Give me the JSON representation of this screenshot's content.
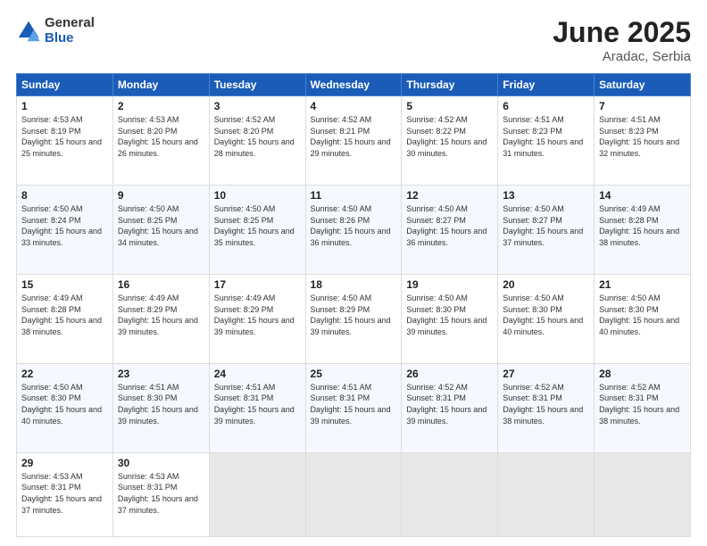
{
  "logo": {
    "general": "General",
    "blue": "Blue"
  },
  "title": {
    "month_year": "June 2025",
    "location": "Aradac, Serbia"
  },
  "headers": [
    "Sunday",
    "Monday",
    "Tuesday",
    "Wednesday",
    "Thursday",
    "Friday",
    "Saturday"
  ],
  "weeks": [
    [
      {
        "day": "1",
        "sunrise": "4:53 AM",
        "sunset": "8:19 PM",
        "daylight": "15 hours and 25 minutes."
      },
      {
        "day": "2",
        "sunrise": "4:53 AM",
        "sunset": "8:20 PM",
        "daylight": "15 hours and 26 minutes."
      },
      {
        "day": "3",
        "sunrise": "4:52 AM",
        "sunset": "8:20 PM",
        "daylight": "15 hours and 28 minutes."
      },
      {
        "day": "4",
        "sunrise": "4:52 AM",
        "sunset": "8:21 PM",
        "daylight": "15 hours and 29 minutes."
      },
      {
        "day": "5",
        "sunrise": "4:52 AM",
        "sunset": "8:22 PM",
        "daylight": "15 hours and 30 minutes."
      },
      {
        "day": "6",
        "sunrise": "4:51 AM",
        "sunset": "8:23 PM",
        "daylight": "15 hours and 31 minutes."
      },
      {
        "day": "7",
        "sunrise": "4:51 AM",
        "sunset": "8:23 PM",
        "daylight": "15 hours and 32 minutes."
      }
    ],
    [
      {
        "day": "8",
        "sunrise": "4:50 AM",
        "sunset": "8:24 PM",
        "daylight": "15 hours and 33 minutes."
      },
      {
        "day": "9",
        "sunrise": "4:50 AM",
        "sunset": "8:25 PM",
        "daylight": "15 hours and 34 minutes."
      },
      {
        "day": "10",
        "sunrise": "4:50 AM",
        "sunset": "8:25 PM",
        "daylight": "15 hours and 35 minutes."
      },
      {
        "day": "11",
        "sunrise": "4:50 AM",
        "sunset": "8:26 PM",
        "daylight": "15 hours and 36 minutes."
      },
      {
        "day": "12",
        "sunrise": "4:50 AM",
        "sunset": "8:27 PM",
        "daylight": "15 hours and 36 minutes."
      },
      {
        "day": "13",
        "sunrise": "4:50 AM",
        "sunset": "8:27 PM",
        "daylight": "15 hours and 37 minutes."
      },
      {
        "day": "14",
        "sunrise": "4:49 AM",
        "sunset": "8:28 PM",
        "daylight": "15 hours and 38 minutes."
      }
    ],
    [
      {
        "day": "15",
        "sunrise": "4:49 AM",
        "sunset": "8:28 PM",
        "daylight": "15 hours and 38 minutes."
      },
      {
        "day": "16",
        "sunrise": "4:49 AM",
        "sunset": "8:29 PM",
        "daylight": "15 hours and 39 minutes."
      },
      {
        "day": "17",
        "sunrise": "4:49 AM",
        "sunset": "8:29 PM",
        "daylight": "15 hours and 39 minutes."
      },
      {
        "day": "18",
        "sunrise": "4:50 AM",
        "sunset": "8:29 PM",
        "daylight": "15 hours and 39 minutes."
      },
      {
        "day": "19",
        "sunrise": "4:50 AM",
        "sunset": "8:30 PM",
        "daylight": "15 hours and 39 minutes."
      },
      {
        "day": "20",
        "sunrise": "4:50 AM",
        "sunset": "8:30 PM",
        "daylight": "15 hours and 40 minutes."
      },
      {
        "day": "21",
        "sunrise": "4:50 AM",
        "sunset": "8:30 PM",
        "daylight": "15 hours and 40 minutes."
      }
    ],
    [
      {
        "day": "22",
        "sunrise": "4:50 AM",
        "sunset": "8:30 PM",
        "daylight": "15 hours and 40 minutes."
      },
      {
        "day": "23",
        "sunrise": "4:51 AM",
        "sunset": "8:30 PM",
        "daylight": "15 hours and 39 minutes."
      },
      {
        "day": "24",
        "sunrise": "4:51 AM",
        "sunset": "8:31 PM",
        "daylight": "15 hours and 39 minutes."
      },
      {
        "day": "25",
        "sunrise": "4:51 AM",
        "sunset": "8:31 PM",
        "daylight": "15 hours and 39 minutes."
      },
      {
        "day": "26",
        "sunrise": "4:52 AM",
        "sunset": "8:31 PM",
        "daylight": "15 hours and 39 minutes."
      },
      {
        "day": "27",
        "sunrise": "4:52 AM",
        "sunset": "8:31 PM",
        "daylight": "15 hours and 38 minutes."
      },
      {
        "day": "28",
        "sunrise": "4:52 AM",
        "sunset": "8:31 PM",
        "daylight": "15 hours and 38 minutes."
      }
    ],
    [
      {
        "day": "29",
        "sunrise": "4:53 AM",
        "sunset": "8:31 PM",
        "daylight": "15 hours and 37 minutes."
      },
      {
        "day": "30",
        "sunrise": "4:53 AM",
        "sunset": "8:31 PM",
        "daylight": "15 hours and 37 minutes."
      },
      null,
      null,
      null,
      null,
      null
    ]
  ]
}
